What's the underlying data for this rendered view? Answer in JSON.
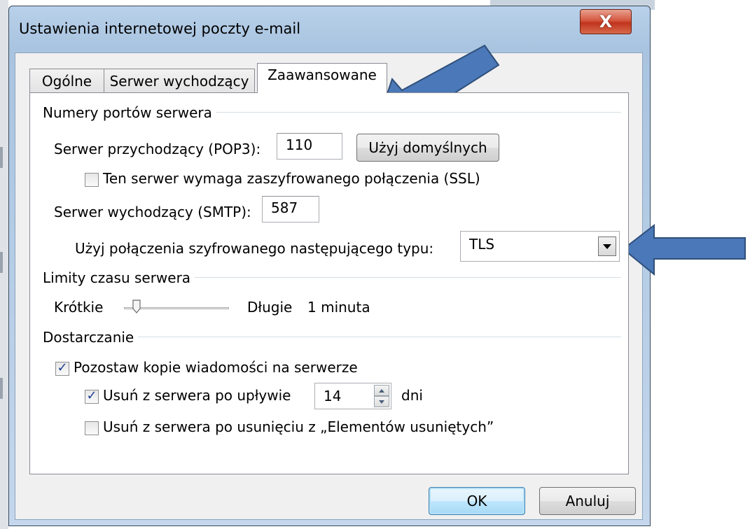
{
  "window": {
    "title": "Ustawienia internetowej poczty e-mail",
    "close_glyph": "X"
  },
  "tabs": [
    {
      "label": "Ogólne",
      "active": false
    },
    {
      "label": "Serwer wychodzący",
      "active": false
    },
    {
      "label": "Zaawansowane",
      "active": true
    }
  ],
  "ports": {
    "group_label": "Numery portów serwera",
    "incoming_label": "Serwer przychodzący (POP3):",
    "incoming_value": "110",
    "use_defaults_label": "Użyj domyślnych",
    "ssl_checkbox_label": "Ten serwer wymaga zaszyfrowanego połączenia (SSL)",
    "ssl_checked": false,
    "outgoing_label": "Serwer wychodzący (SMTP):",
    "outgoing_value": "587",
    "encryption_label": "Użyj połączenia szyfrowanego następującego typu:",
    "encryption_value": "TLS"
  },
  "timeouts": {
    "group_label": "Limity czasu serwera",
    "short_label": "Krótkie",
    "long_label": "Długie",
    "value_text": "1 minuta",
    "slider_level": 0.12
  },
  "delivery": {
    "group_label": "Dostarczanie",
    "leave_copy_label": "Pozostaw kopie wiadomości na serwerze",
    "leave_copy_checked": true,
    "remove_after_label": "Usuń z serwera po upływie",
    "remove_after_checked": true,
    "days_value": "14",
    "days_unit": "dni",
    "remove_deleted_label": "Usuń z serwera po usunięciu z „Elementów usuniętych”",
    "remove_deleted_checked": false
  },
  "buttons": {
    "ok_label": "OK",
    "cancel_label": "Anuluj"
  },
  "colors": {
    "annotation_arrow": "#4a78b8",
    "annotation_outline": "#2f4f7a"
  },
  "icons": {
    "check": "checkmark-icon",
    "combo": "chevron-down-icon",
    "close": "close-icon"
  }
}
